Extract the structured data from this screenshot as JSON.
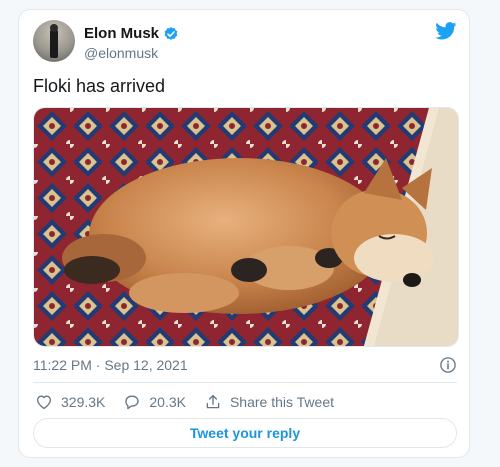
{
  "tweet": {
    "author_name": "Elon Musk",
    "author_handle": "@elonmusk",
    "verified": true,
    "text": "Floki has arrived",
    "timestamp": "11:22 PM · Sep 12, 2021",
    "likes": "329.3K",
    "replies": "20.3K",
    "share_label": "Share this Tweet",
    "reply_button_label": "Tweet your reply"
  },
  "icons": {
    "brand": "twitter-bird-icon",
    "verified": "verified-badge-icon",
    "info": "info-icon",
    "like": "heart-icon",
    "reply": "reply-bubble-icon",
    "share": "share-icon"
  },
  "colors": {
    "accent": "#1da1f2",
    "link": "#1b95e0",
    "text": "#14171a",
    "muted": "#657786",
    "border": "#e1e8ed"
  }
}
